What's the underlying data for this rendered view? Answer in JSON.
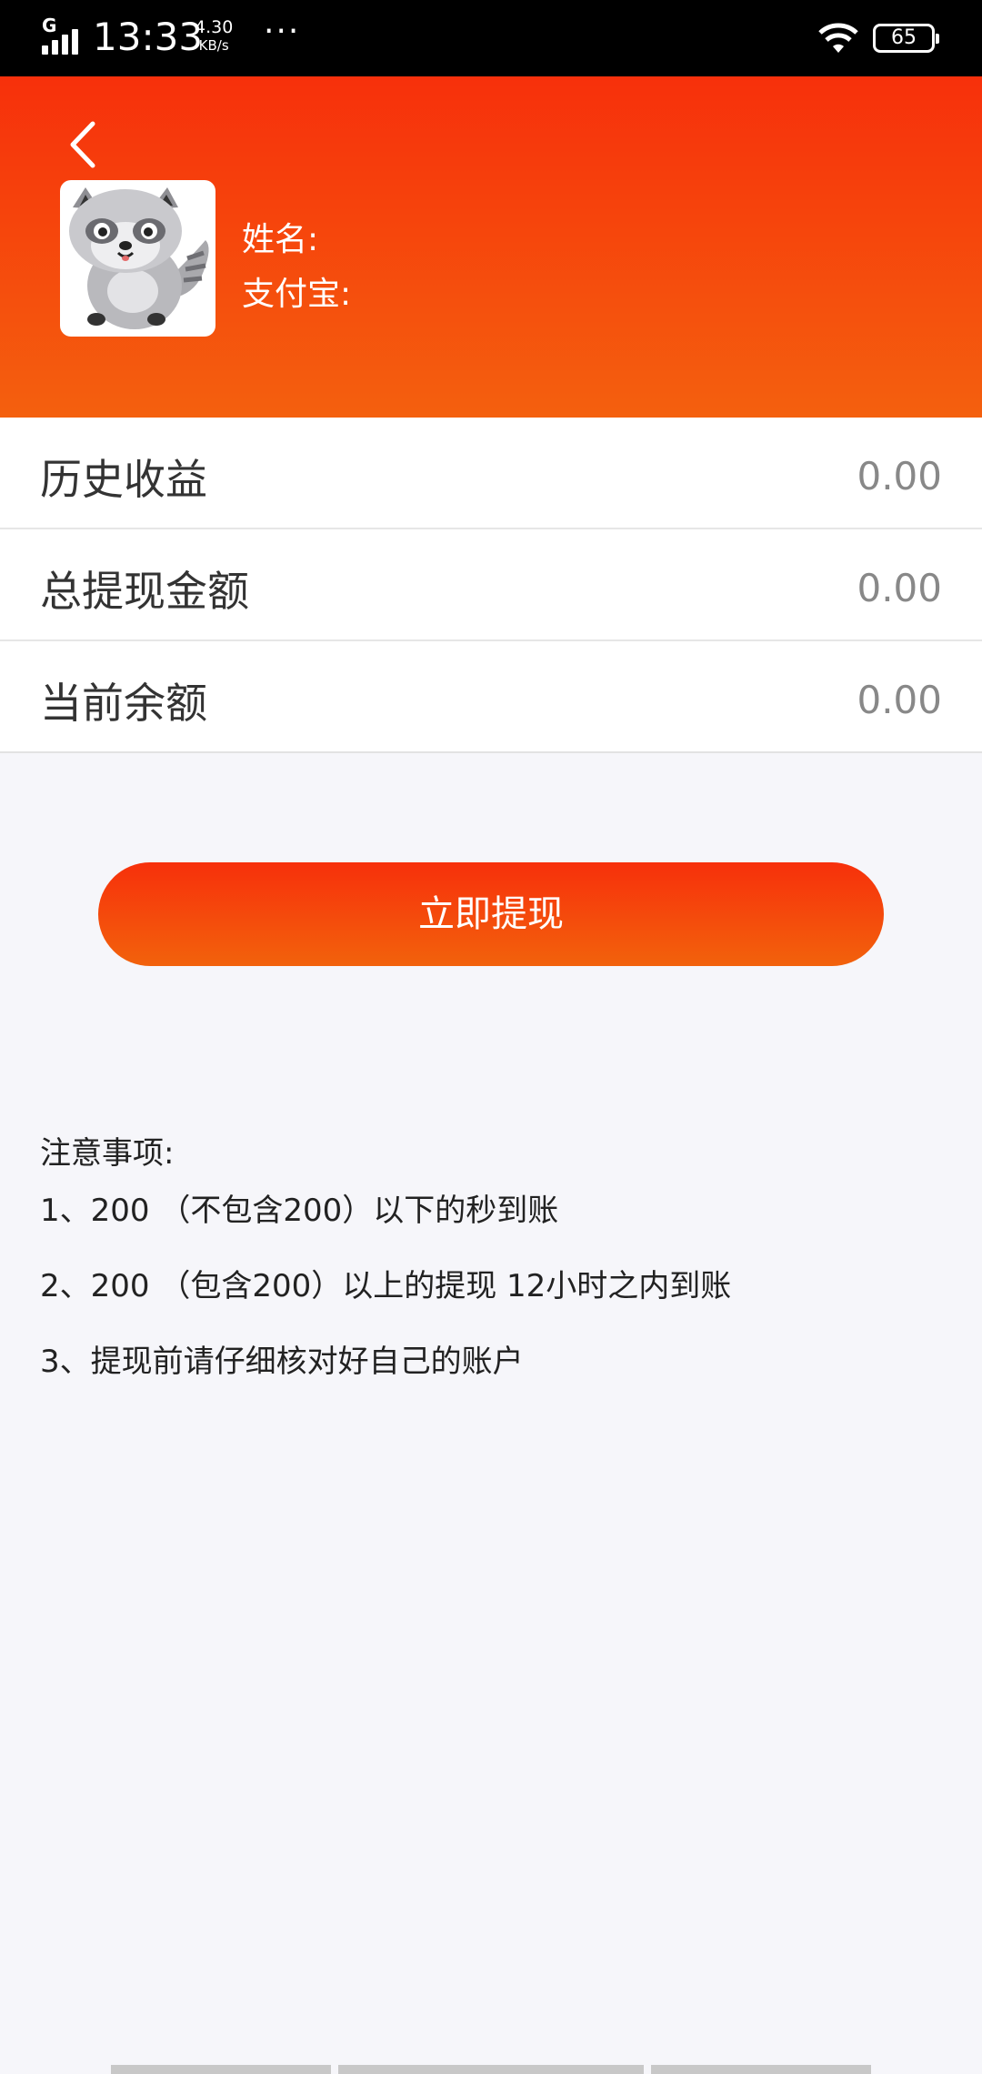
{
  "status_bar": {
    "network": "G",
    "time": "13:33",
    "speed_value": "4.30",
    "speed_unit": "KB/s",
    "more": "···",
    "battery": "65"
  },
  "header": {
    "name_label": "姓名:",
    "alipay_label": "支付宝:",
    "avatar_icon": "raccoon-avatar-icon",
    "colors": {
      "gradient_top": "#f7300b",
      "gradient_bottom": "#f4600e"
    }
  },
  "stats": [
    {
      "label": "历史收益",
      "value": "0.00"
    },
    {
      "label": "总提现金额",
      "value": "0.00"
    },
    {
      "label": "当前余额",
      "value": "0.00"
    }
  ],
  "withdraw_button": {
    "label": "立即提现"
  },
  "notes": {
    "title": "注意事项:",
    "items": [
      "1、200 （不包含200）以下的秒到账",
      "2、200 （包含200）以上的提现 12小时之内到账",
      "3、提现前请仔细核对好自己的账户"
    ]
  }
}
